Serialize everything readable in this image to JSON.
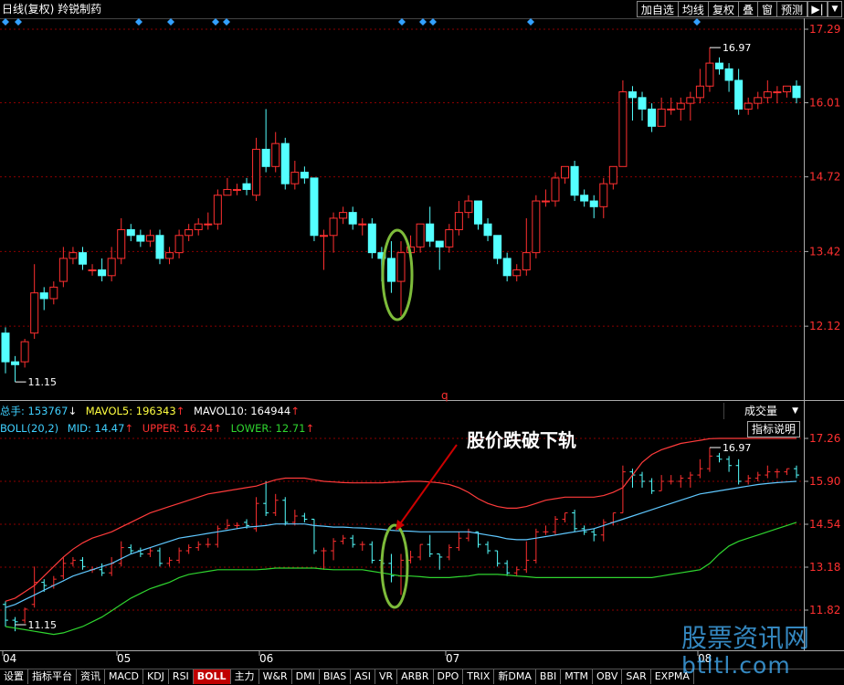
{
  "window": {
    "title": "日线(复权)  羚锐制药",
    "buttons": [
      "加自选",
      "均线",
      "复权",
      "叠",
      "窗",
      "预测"
    ],
    "nav_icon": "▶|",
    "dropdown_icon": "▼"
  },
  "main_chart": {
    "y_ticks": [
      "17.29",
      "16.01",
      "14.72",
      "13.42",
      "12.12"
    ],
    "high_label": "16.97",
    "low_label": "11.15",
    "q_marker": "q"
  },
  "volume_info": {
    "total_label": "总手: 153767",
    "total_arrow": "↓",
    "mavol5_label": "MAVOL5: 196343",
    "mavol5_arrow": "↑",
    "mavol10_label": "MAVOL10: 164944",
    "mavol10_arrow": "↑"
  },
  "boll_info": {
    "name": "BOLL(20,2)",
    "mid_label": "MID: 14.47",
    "mid_arrow": "↑",
    "upper_label": "UPPER: 16.24",
    "upper_arrow": "↑",
    "lower_label": "LOWER: 12.71",
    "lower_arrow": "↑"
  },
  "indicator_panel": {
    "selector_value": "成交量",
    "explain_button": "指标说明",
    "y_ticks": [
      "17.26",
      "15.90",
      "14.54",
      "13.18",
      "11.82"
    ],
    "high_label": "16.97",
    "low_label": "11.15",
    "annotation": "股价跌破下轨"
  },
  "x_axis_labels": [
    "04",
    "05",
    "06",
    "07",
    "08"
  ],
  "tabs": [
    "设置",
    "指标平台",
    "资讯",
    "MACD",
    "KDJ",
    "RSI",
    "BOLL",
    "主力",
    "W&R",
    "DMI",
    "BIAS",
    "ASI",
    "VR",
    "ARBR",
    "DPO",
    "TRIX",
    "新DMA",
    "BBI",
    "MTM",
    "OBV",
    "SAR",
    "EXPMA"
  ],
  "active_tab": "BOLL",
  "watermark": {
    "line1": "股票资讯网",
    "line2": "btltl.com"
  },
  "colors": {
    "up": "#ff3030",
    "down": "#54ffff",
    "mid": "#5fc8ff",
    "upper": "#ff3b3b",
    "lower": "#2fd52f",
    "grid": "#8b0000",
    "circle": "#7dbb3a",
    "signal": "#33a0ff"
  },
  "chart_data": {
    "type": "candlestick",
    "price_axis": {
      "min": 11.2,
      "max": 17.29
    },
    "boll_axis": {
      "min": 11.82,
      "max": 17.26
    },
    "candles": [
      [
        12.0,
        11.5,
        12.1,
        11.3
      ],
      [
        11.5,
        11.45,
        11.6,
        11.15
      ],
      [
        11.5,
        11.85,
        11.9,
        11.4
      ],
      [
        12.0,
        12.7,
        13.2,
        11.9
      ],
      [
        12.7,
        12.6,
        12.8,
        12.4
      ],
      [
        12.6,
        12.8,
        12.9,
        12.5
      ],
      [
        12.9,
        13.3,
        13.5,
        12.8
      ],
      [
        13.3,
        13.4,
        13.5,
        13.2
      ],
      [
        13.4,
        13.2,
        13.5,
        13.1
      ],
      [
        13.1,
        13.1,
        13.2,
        13.0
      ],
      [
        13.1,
        13.0,
        13.3,
        12.9
      ],
      [
        13.0,
        13.3,
        13.5,
        12.9
      ],
      [
        13.3,
        13.8,
        14.0,
        13.2
      ],
      [
        13.8,
        13.7,
        13.9,
        13.6
      ],
      [
        13.7,
        13.6,
        13.8,
        13.5
      ],
      [
        13.6,
        13.7,
        13.8,
        13.5
      ],
      [
        13.7,
        13.3,
        13.8,
        13.2
      ],
      [
        13.3,
        13.4,
        13.5,
        13.2
      ],
      [
        13.4,
        13.7,
        13.8,
        13.3
      ],
      [
        13.7,
        13.8,
        13.9,
        13.6
      ],
      [
        13.8,
        13.9,
        14.0,
        13.7
      ],
      [
        13.9,
        13.9,
        14.1,
        13.8
      ],
      [
        13.9,
        14.4,
        14.5,
        13.8
      ],
      [
        14.4,
        14.5,
        14.7,
        14.4
      ],
      [
        14.5,
        14.5,
        14.6,
        14.4
      ],
      [
        14.6,
        14.5,
        14.7,
        14.4
      ],
      [
        14.4,
        15.2,
        15.4,
        14.3
      ],
      [
        15.2,
        14.9,
        15.9,
        14.8
      ],
      [
        14.9,
        15.3,
        15.5,
        14.8
      ],
      [
        15.3,
        14.6,
        15.4,
        14.5
      ],
      [
        14.6,
        14.8,
        15.0,
        14.5
      ],
      [
        14.8,
        14.7,
        14.9,
        14.6
      ],
      [
        14.7,
        13.7,
        14.7,
        13.6
      ],
      [
        13.7,
        13.7,
        13.8,
        13.1
      ],
      [
        13.7,
        14.0,
        14.1,
        13.4
      ],
      [
        14.0,
        14.1,
        14.2,
        13.9
      ],
      [
        14.1,
        13.9,
        14.2,
        13.8
      ],
      [
        13.9,
        13.9,
        14.0,
        13.7
      ],
      [
        13.9,
        13.4,
        14.0,
        13.3
      ],
      [
        13.4,
        13.3,
        13.5,
        12.9
      ],
      [
        13.3,
        12.9,
        13.6,
        12.7
      ],
      [
        12.9,
        13.4,
        13.6,
        12.3
      ],
      [
        13.4,
        13.5,
        13.7,
        13.3
      ],
      [
        13.5,
        13.9,
        13.9,
        13.4
      ],
      [
        13.9,
        13.6,
        14.2,
        13.5
      ],
      [
        13.6,
        13.5,
        13.6,
        13.1
      ],
      [
        13.5,
        13.8,
        13.9,
        13.4
      ],
      [
        13.8,
        14.1,
        14.3,
        13.7
      ],
      [
        14.1,
        14.3,
        14.4,
        14.0
      ],
      [
        14.3,
        13.9,
        14.3,
        13.8
      ],
      [
        13.9,
        13.7,
        14.0,
        13.6
      ],
      [
        13.7,
        13.3,
        13.7,
        13.2
      ],
      [
        13.3,
        13.0,
        13.4,
        12.9
      ],
      [
        13.0,
        13.1,
        13.2,
        12.9
      ],
      [
        13.1,
        13.4,
        14.0,
        13.0
      ],
      [
        13.4,
        14.3,
        14.4,
        13.3
      ],
      [
        14.3,
        14.3,
        14.5,
        14.2
      ],
      [
        14.3,
        14.7,
        14.8,
        14.2
      ],
      [
        14.7,
        14.9,
        14.9,
        14.6
      ],
      [
        14.9,
        14.4,
        15.0,
        14.3
      ],
      [
        14.4,
        14.3,
        14.5,
        14.2
      ],
      [
        14.3,
        14.2,
        14.4,
        14.0
      ],
      [
        14.2,
        14.6,
        14.7,
        14.0
      ],
      [
        14.6,
        14.9,
        14.9,
        14.5
      ],
      [
        14.9,
        16.2,
        16.4,
        14.9
      ],
      [
        16.2,
        16.1,
        16.3,
        15.7
      ],
      [
        16.1,
        15.9,
        16.2,
        15.7
      ],
      [
        15.9,
        15.6,
        16.0,
        15.5
      ],
      [
        15.6,
        15.9,
        16.1,
        15.6
      ],
      [
        15.9,
        15.9,
        16.1,
        15.8
      ],
      [
        15.9,
        16.0,
        16.1,
        15.7
      ],
      [
        16.0,
        16.1,
        16.2,
        15.7
      ],
      [
        16.1,
        16.3,
        16.6,
        16.0
      ],
      [
        16.3,
        16.7,
        16.97,
        16.2
      ],
      [
        16.7,
        16.6,
        16.8,
        16.5
      ],
      [
        16.6,
        16.4,
        16.7,
        16.2
      ],
      [
        16.4,
        15.9,
        16.6,
        15.8
      ],
      [
        15.9,
        16.0,
        16.1,
        15.8
      ],
      [
        16.0,
        16.1,
        16.2,
        15.9
      ],
      [
        16.1,
        16.2,
        16.4,
        16.0
      ],
      [
        16.2,
        16.2,
        16.3,
        16.0
      ],
      [
        16.2,
        16.3,
        16.3,
        16.1
      ],
      [
        16.3,
        16.1,
        16.4,
        16.0
      ]
    ],
    "boll_mid": [
      11.9,
      12.0,
      12.15,
      12.3,
      12.45,
      12.6,
      12.75,
      12.9,
      13.0,
      13.1,
      13.2,
      13.3,
      13.45,
      13.6,
      13.7,
      13.8,
      13.9,
      14.0,
      14.1,
      14.15,
      14.2,
      14.25,
      14.3,
      14.35,
      14.4,
      14.45,
      14.47,
      14.5,
      14.55,
      14.55,
      14.55,
      14.55,
      14.5,
      14.48,
      14.45,
      14.45,
      14.43,
      14.42,
      14.4,
      14.38,
      14.35,
      14.33,
      14.32,
      14.3,
      14.3,
      14.3,
      14.3,
      14.3,
      14.3,
      14.25,
      14.2,
      14.15,
      14.08,
      14.05,
      14.05,
      14.1,
      14.15,
      14.2,
      14.25,
      14.3,
      14.35,
      14.4,
      14.5,
      14.6,
      14.7,
      14.8,
      14.9,
      15.0,
      15.1,
      15.2,
      15.3,
      15.4,
      15.5,
      15.55,
      15.6,
      15.65,
      15.7,
      15.75,
      15.8,
      15.83,
      15.86,
      15.88,
      15.9
    ],
    "boll_upper": [
      12.1,
      12.2,
      12.4,
      12.6,
      12.9,
      13.2,
      13.5,
      13.75,
      13.95,
      14.1,
      14.2,
      14.3,
      14.45,
      14.6,
      14.75,
      14.9,
      15.0,
      15.1,
      15.2,
      15.3,
      15.4,
      15.5,
      15.55,
      15.6,
      15.65,
      15.7,
      15.75,
      15.85,
      15.95,
      16.0,
      16.0,
      16.0,
      15.95,
      15.9,
      15.88,
      15.86,
      15.85,
      15.85,
      15.85,
      15.85,
      15.87,
      15.88,
      15.9,
      15.9,
      15.88,
      15.85,
      15.8,
      15.7,
      15.55,
      15.35,
      15.2,
      15.1,
      15.05,
      15.05,
      15.1,
      15.2,
      15.3,
      15.35,
      15.4,
      15.4,
      15.4,
      15.4,
      15.45,
      15.55,
      15.7,
      16.1,
      16.5,
      16.75,
      16.9,
      17.0,
      17.1,
      17.15,
      17.2,
      17.25,
      17.26,
      17.26,
      17.26,
      17.26,
      17.26,
      17.26,
      17.26,
      17.26,
      17.26
    ],
    "boll_lower": [
      11.3,
      11.25,
      11.2,
      11.15,
      11.1,
      11.05,
      11.1,
      11.2,
      11.3,
      11.45,
      11.6,
      11.8,
      12.0,
      12.2,
      12.35,
      12.5,
      12.6,
      12.7,
      12.85,
      12.95,
      13.0,
      13.05,
      13.1,
      13.1,
      13.1,
      13.1,
      13.1,
      13.12,
      13.15,
      13.15,
      13.15,
      13.15,
      13.15,
      13.12,
      13.1,
      13.1,
      13.1,
      13.1,
      13.05,
      13.0,
      12.95,
      12.9,
      12.9,
      12.88,
      12.85,
      12.85,
      12.85,
      12.88,
      12.9,
      12.95,
      12.95,
      12.95,
      12.93,
      12.9,
      12.88,
      12.85,
      12.85,
      12.85,
      12.85,
      12.85,
      12.85,
      12.85,
      12.85,
      12.85,
      12.85,
      12.85,
      12.85,
      12.85,
      12.9,
      12.95,
      13.0,
      13.05,
      13.1,
      13.3,
      13.6,
      13.85,
      14.0,
      14.1,
      14.2,
      14.3,
      14.4,
      14.5,
      14.6
    ]
  }
}
